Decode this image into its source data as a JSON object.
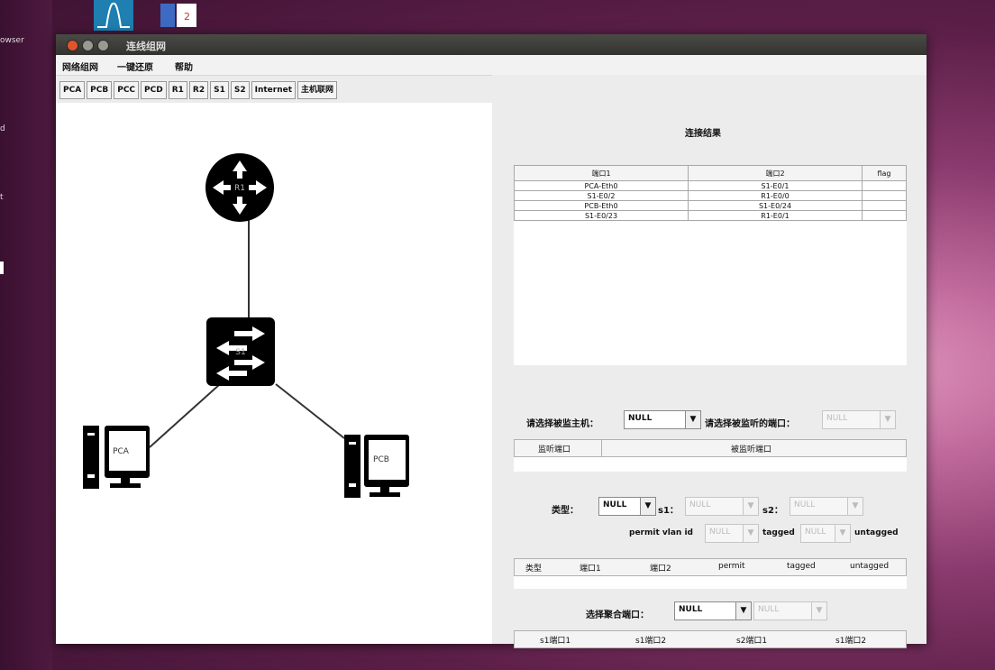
{
  "desktop": {
    "sidebar_texts": [
      "owser",
      "d",
      "t"
    ],
    "dock_icons": [
      "signal-wave-icon",
      "document-icon"
    ]
  },
  "window": {
    "title": "连线组网",
    "menu": [
      "网络组网",
      "一键还原",
      "帮助"
    ],
    "device_tabs": [
      "PCA",
      "PCB",
      "PCC",
      "PCD",
      "R1",
      "R2",
      "S1",
      "S2",
      "Internet",
      "主机联网"
    ]
  },
  "topology": {
    "router_label": "R1",
    "switch_label": "S1",
    "pc_left_label": "PCA",
    "pc_right_label": "PCB"
  },
  "connections": {
    "title": "连接结果",
    "columns": [
      "端口1",
      "端口2",
      "flag"
    ],
    "rows": [
      [
        "PCA-Eth0",
        "S1-E0/1",
        ""
      ],
      [
        "S1-E0/2",
        "R1-E0/0",
        ""
      ],
      [
        "PCB-Eth0",
        "S1-E0/24",
        ""
      ],
      [
        "S1-E0/23",
        "R1-E0/1",
        ""
      ]
    ]
  },
  "monitor": {
    "host_label": "请选择被监主机：",
    "host_value": "NULL",
    "port_label": "请选择被监听的端口：",
    "port_value": "NULL",
    "columns": [
      "监听端口",
      "被监听端口"
    ]
  },
  "vlan": {
    "type_label": "类型：",
    "type_value": "NULL",
    "s1_label": "s1：",
    "s1_value": "NULL",
    "s2_label": "s2：",
    "s2_value": "NULL",
    "permit_label": "permit vlan id",
    "permit_value": "NULL",
    "tagged_label": "tagged",
    "tagged_value": "NULL",
    "untagged_label": "untagged",
    "columns": [
      "类型",
      "端口1",
      "端口2",
      "permit",
      "tagged",
      "untagged"
    ]
  },
  "aggregation": {
    "label": "选择聚合端口：",
    "value1": "NULL",
    "value2": "NULL",
    "columns": [
      "s1端口1",
      "s1端口2",
      "s2端口1",
      "s1端口2"
    ]
  }
}
